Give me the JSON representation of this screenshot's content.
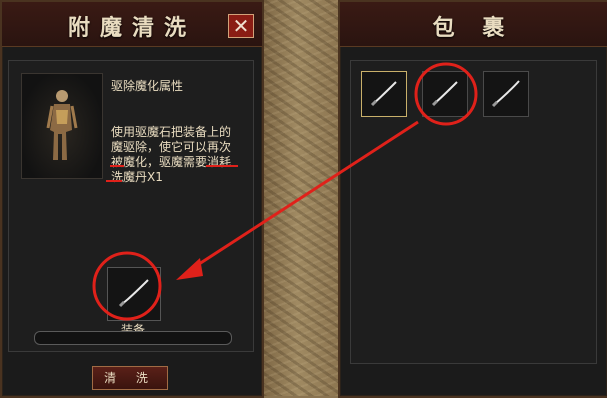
{
  "left_panel": {
    "title": "附魔清洗",
    "close_label": "✕",
    "desc_title": "驱除魔化属性",
    "desc_text": "使用驱魔石把装备上的魔驱除，使它可以再次被魔化，驱魔需要消耗洗魔丹X1",
    "equip_label": "装备",
    "clean_button": "清 洗"
  },
  "right_panel": {
    "title": "包 裹",
    "items": [
      {
        "icon": "blade-icon",
        "selected": true
      },
      {
        "icon": "sword-icon",
        "selected": false
      },
      {
        "icon": "saber-icon",
        "selected": false
      }
    ]
  },
  "colors": {
    "title_text": "#e9dcc0",
    "annotation_red": "#e0211a",
    "selected_border": "#c9b06a"
  }
}
